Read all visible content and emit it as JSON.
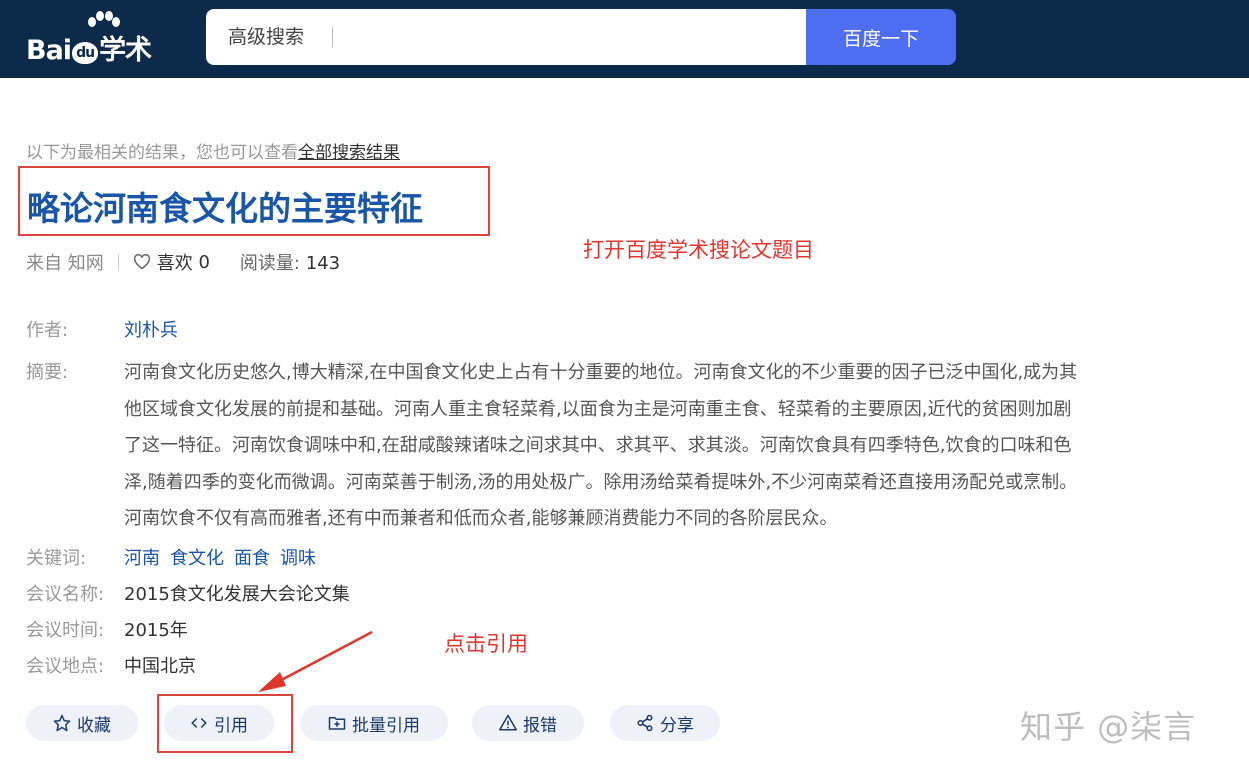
{
  "header": {
    "logo_text": "Bai",
    "logo_du": "du",
    "logo_suffix": "学术",
    "search_placeholder": "高级搜索",
    "search_button": "百度一下"
  },
  "result": {
    "hint_prefix": "以下为最相关的结果，您也可以查看",
    "hint_link": "全部搜索结果",
    "title": "略论河南食文化的主要特征",
    "source": "来自 知网",
    "likes_label": "喜欢",
    "likes_count": "0",
    "reads_label": "阅读量:",
    "reads_count": "143",
    "author_label": "作者:",
    "author": "刘朴兵",
    "abstract_label": "摘要:",
    "abstract_lines": [
      "河南食文化历史悠久,博大精深,在中国食文化史上占有十分重要的地位。河南食文化的不少重要的因子已泛中国化,成为其",
      "他区域食文化发展的前提和基础。河南人重主食轻菜肴,以面食为主是河南重主食、轻菜肴的主要原因,近代的贫困则加剧",
      "了这一特征。河南饮食调味中和,在甜咸酸辣诸味之间求其中、求其平、求其淡。河南饮食具有四季特色,饮食的口味和色",
      "泽,随着四季的变化而微调。河南菜善于制汤,汤的用处极广。除用汤给菜肴提味外,不少河南菜肴还直接用汤配兑或烹制。",
      "河南饮食不仅有高而雅者,还有中而兼者和低而众者,能够兼顾消费能力不同的各阶层民众。"
    ],
    "keywords_label": "关键词:",
    "keywords": [
      "河南",
      "食文化",
      "面食",
      "调味"
    ],
    "conference_name_label": "会议名称:",
    "conference_name": "2015食文化发展大会论文集",
    "conference_time_label": "会议时间:",
    "conference_time": "2015年",
    "conference_place_label": "会议地点:",
    "conference_place": "中国北京"
  },
  "actions": {
    "collect": "收藏",
    "cite": "引用",
    "batch_cite": "批量引用",
    "report": "报错",
    "share": "分享"
  },
  "annotations": {
    "open_hint": "打开百度学术搜论文题目",
    "click_hint": "点击引用"
  },
  "watermark": "知乎 @柒言",
  "colors": {
    "header_bg": "#0c2a4a",
    "search_button": "#4e6ef2",
    "title": "#1a56a8",
    "annotation_red": "#e0362c",
    "action_bg": "#eef2f8"
  }
}
